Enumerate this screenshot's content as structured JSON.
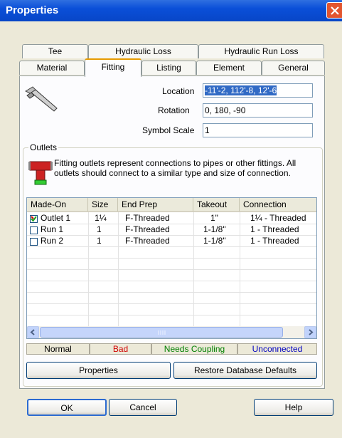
{
  "window": {
    "title": "Properties"
  },
  "tabs_row1": [
    "Tee",
    "Hydraulic Loss",
    "Hydraulic Run Loss"
  ],
  "tabs_row2": [
    "Material",
    "Fitting",
    "Listing",
    "Element",
    "General"
  ],
  "active_tab": "Fitting",
  "fitting": {
    "location_label": "Location",
    "location_value": "-11'-2, 112'-8, 12'-6",
    "rotation_label": "Rotation",
    "rotation_value": "0, 180, -90",
    "symbol_scale_label": "Symbol Scale",
    "symbol_scale_value": "1"
  },
  "outlets": {
    "group_label": "Outlets",
    "description": "Fitting outlets represent connections to pipes or other fittings. All outlets should connect to a similar type and size of connection.",
    "columns": [
      "Made-On",
      "Size",
      "End Prep",
      "Takeout",
      "Connection"
    ],
    "rows": [
      {
        "name": "Outlet 1",
        "size": "1¼",
        "end_prep": "F-Threaded",
        "takeout": "1\"",
        "connection": "1¼ - Threaded"
      },
      {
        "name": "Run 1",
        "size": "1",
        "end_prep": "F-Threaded",
        "takeout": "1-1/8\"",
        "connection": "1 - Threaded"
      },
      {
        "name": "Run 2",
        "size": "1",
        "end_prep": "F-Threaded",
        "takeout": "1-1/8\"",
        "connection": "1 - Threaded"
      }
    ],
    "legend": {
      "normal": "Normal",
      "bad": "Bad",
      "needs_coupling": "Needs Coupling",
      "unconnected": "Unconnected"
    },
    "properties_button": "Properties",
    "restore_button": "Restore Database Defaults"
  },
  "buttons": {
    "ok": "OK",
    "cancel": "Cancel",
    "help": "Help"
  },
  "colors": {
    "bad": "#d00000",
    "needs_coupling": "#008000",
    "unconnected": "#0000c0",
    "title_bar": "#0a4fd8"
  }
}
